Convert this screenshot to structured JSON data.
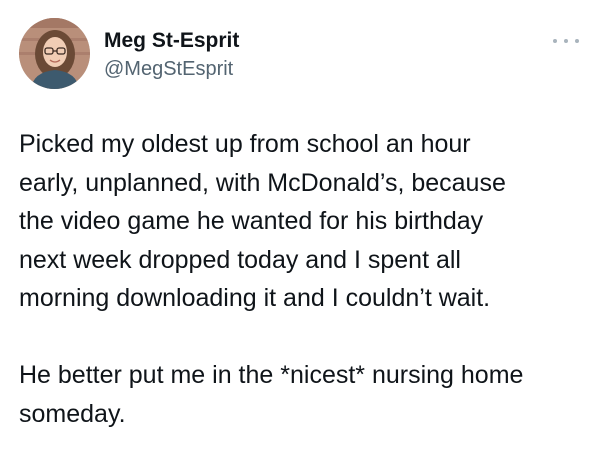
{
  "author": {
    "display_name": "Meg St-Esprit",
    "handle": "@MegStEsprit"
  },
  "more_menu_icon": "more-horizontal-icon",
  "tweet": {
    "paragraphs": [
      "Picked my oldest up from school an hour\nearly, unplanned, with McDonald’s, because\nthe video game he wanted for his birthday\nnext week dropped today and I spent all\nmorning downloading it and I couldn’t wait.",
      "He better put me in the *nicest* nursing home\nsomeday."
    ]
  },
  "colors": {
    "text": "#0f1419",
    "secondary_text": "#536471",
    "icon_gray": "#a9b4bd",
    "background": "#ffffff"
  }
}
